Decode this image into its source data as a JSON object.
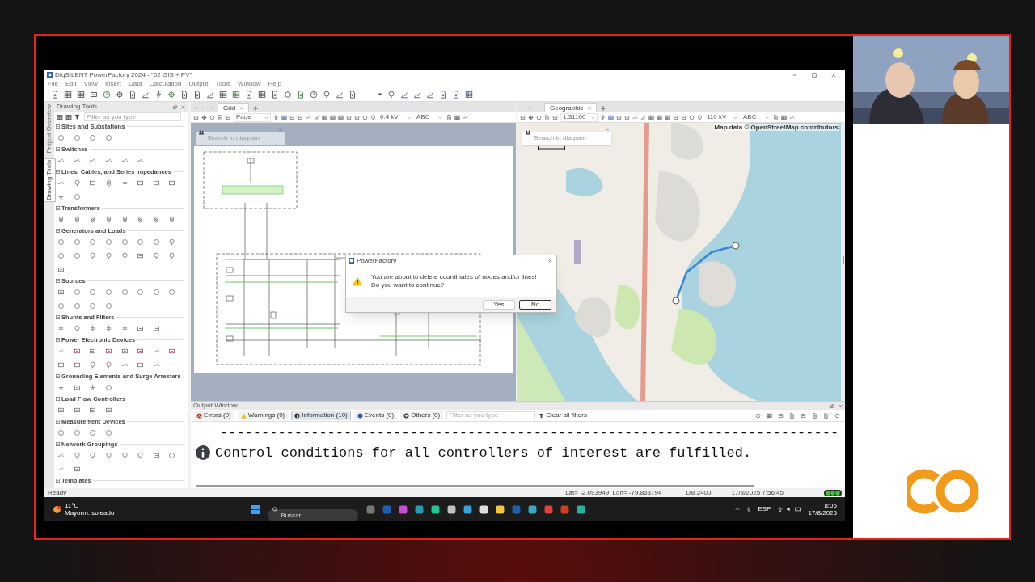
{
  "window": {
    "title": "DIgSILENT PowerFactory 2024 - \"02 GIS + PV\""
  },
  "menu": [
    "File",
    "Edit",
    "View",
    "Insert",
    "Data",
    "Calculation",
    "Output",
    "Tools",
    "Window",
    "Help"
  ],
  "side_tabs": [
    {
      "label": "Project Overview",
      "selected": false
    },
    {
      "label": "Drawing Tools",
      "selected": true
    }
  ],
  "drawing_tools": {
    "title": "Drawing Tools",
    "filter": {
      "placeholder": "Filter as you type"
    },
    "categories": [
      {
        "label": "Sites and Substations",
        "expanded": true
      },
      {
        "label": "Switches",
        "expanded": true
      },
      {
        "label": "Lines, Cables, and Series Impedances",
        "expanded": true
      },
      {
        "label": "Transformers",
        "expanded": true
      },
      {
        "label": "Generators and Loads",
        "expanded": true
      },
      {
        "label": "Sources",
        "expanded": true
      },
      {
        "label": "Shunts and Filters",
        "expanded": true
      },
      {
        "label": "Power Electronic Devices",
        "expanded": true
      },
      {
        "label": "Grounding Elements and Surge Arresters",
        "expanded": true
      },
      {
        "label": "Load Flow Controllers",
        "expanded": true
      },
      {
        "label": "Measurement Devices",
        "expanded": true
      },
      {
        "label": "Network Groupings",
        "expanded": true
      },
      {
        "label": "Templates",
        "expanded": true
      }
    ]
  },
  "diagrams": [
    {
      "kind": "schematic",
      "tab": "Grid",
      "zoom": "Page",
      "voltage": "0.4 kV",
      "labels": "ABC",
      "search": {
        "placeholder": "Search in diagram"
      }
    },
    {
      "kind": "map",
      "tab": "Geographic",
      "zoom": "1:31100",
      "voltage": "110 kV",
      "labels": "ABC",
      "search": {
        "placeholder": "Search in diagram"
      },
      "attribution": "Map data © OpenStreetMap contributors"
    }
  ],
  "dialog": {
    "title": "PowerFactory",
    "message": [
      "You are about to delete coordinates of nodes and/or lines!",
      "Do you want to continue?"
    ],
    "buttons": [
      {
        "label": "Yes",
        "selected": false
      },
      {
        "label": "No",
        "selected": true
      }
    ]
  },
  "output_window": {
    "title": "Output Window",
    "filters": [
      {
        "kind": "error",
        "label": "Errors (0)",
        "selected": false
      },
      {
        "kind": "warning",
        "label": "Warnings (0)",
        "selected": false
      },
      {
        "kind": "info",
        "label": "Information (10)",
        "selected": true
      },
      {
        "kind": "event",
        "label": "Events (0)",
        "selected": false
      },
      {
        "kind": "other",
        "label": "Others (0)",
        "selected": false
      }
    ],
    "filter_field": {
      "placeholder": "Filter as you type"
    },
    "clear_filters": "Clear all filters",
    "messages": [
      {
        "kind": "separator",
        "text": "---------------------------------------------------------------------------"
      },
      {
        "kind": "info",
        "text": "Control conditions for all controllers of interest are fulfilled."
      }
    ]
  },
  "status_bar": {
    "state": "Ready",
    "coordinates": "Lat= -2.093949, Lon= -79.863794",
    "database": "DB 2400",
    "timestamp": "17/8/2025 7:56:45"
  },
  "taskbar": {
    "temperature": "11°C",
    "weather": "Mayorm. soleado",
    "search": {
      "placeholder": "Buscar"
    },
    "language": "ESP",
    "time": "8:06",
    "date": "17/8/2025"
  }
}
